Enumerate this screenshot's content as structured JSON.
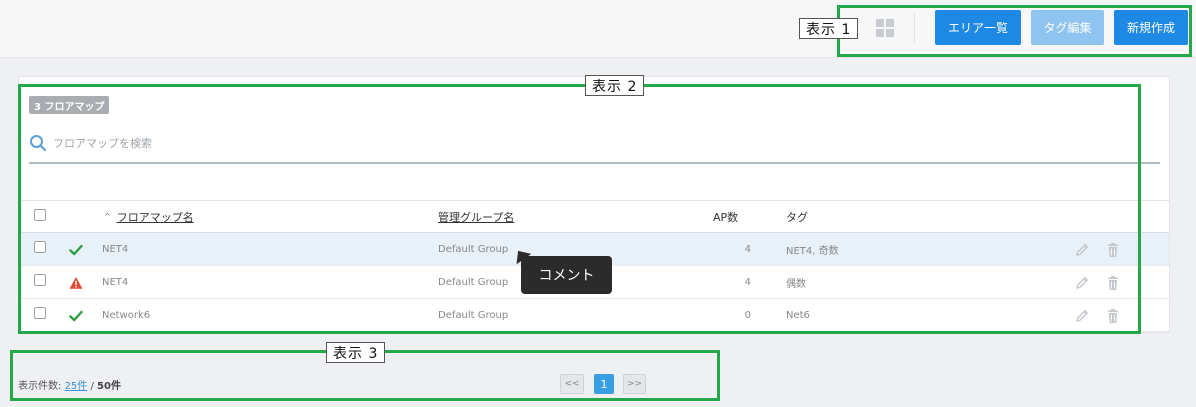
{
  "toolbar": {
    "area_list_label": "エリア一覧",
    "tag_edit_label": "タグ編集",
    "new_create_label": "新規作成"
  },
  "annotations": {
    "label1": "表示 1",
    "label2": "表示 2",
    "label3": "表示 3",
    "color": "#25a84a"
  },
  "floor_map": {
    "count_badge": "3 フロアマップ",
    "search_placeholder": "フロアマップを検索",
    "columns": {
      "sort_caret": "^",
      "name": "フロアマップ名",
      "group": "管理グループ名",
      "ap_count": "AP数",
      "tag": "タグ"
    },
    "rows": [
      {
        "status": "ok",
        "status_icon": "check-icon",
        "name": "NET4",
        "group": "Default Group",
        "ap_count": "4",
        "tag": "NET4, 奇数",
        "highlighted": true
      },
      {
        "status": "warning",
        "status_icon": "warning-icon",
        "name": "NET4",
        "group": "Default Group",
        "ap_count": "4",
        "tag": "偶数",
        "highlighted": false
      },
      {
        "status": "ok",
        "status_icon": "check-icon",
        "name": "Network6",
        "group": "Default Group",
        "ap_count": "0",
        "tag": "Net6",
        "highlighted": false
      }
    ],
    "tooltip": "コメント"
  },
  "footer": {
    "display_count_label": "表示件数:",
    "per_page_link": "25件",
    "separator": "/",
    "total": "50件"
  },
  "pagination": {
    "prev": "<<",
    "current": "1",
    "next": ">>"
  },
  "colors": {
    "primary_button": "#1e88e5",
    "disabled_button": "#8fc3f0",
    "ok": "#2e9e3e",
    "warning": "#e04b33"
  }
}
